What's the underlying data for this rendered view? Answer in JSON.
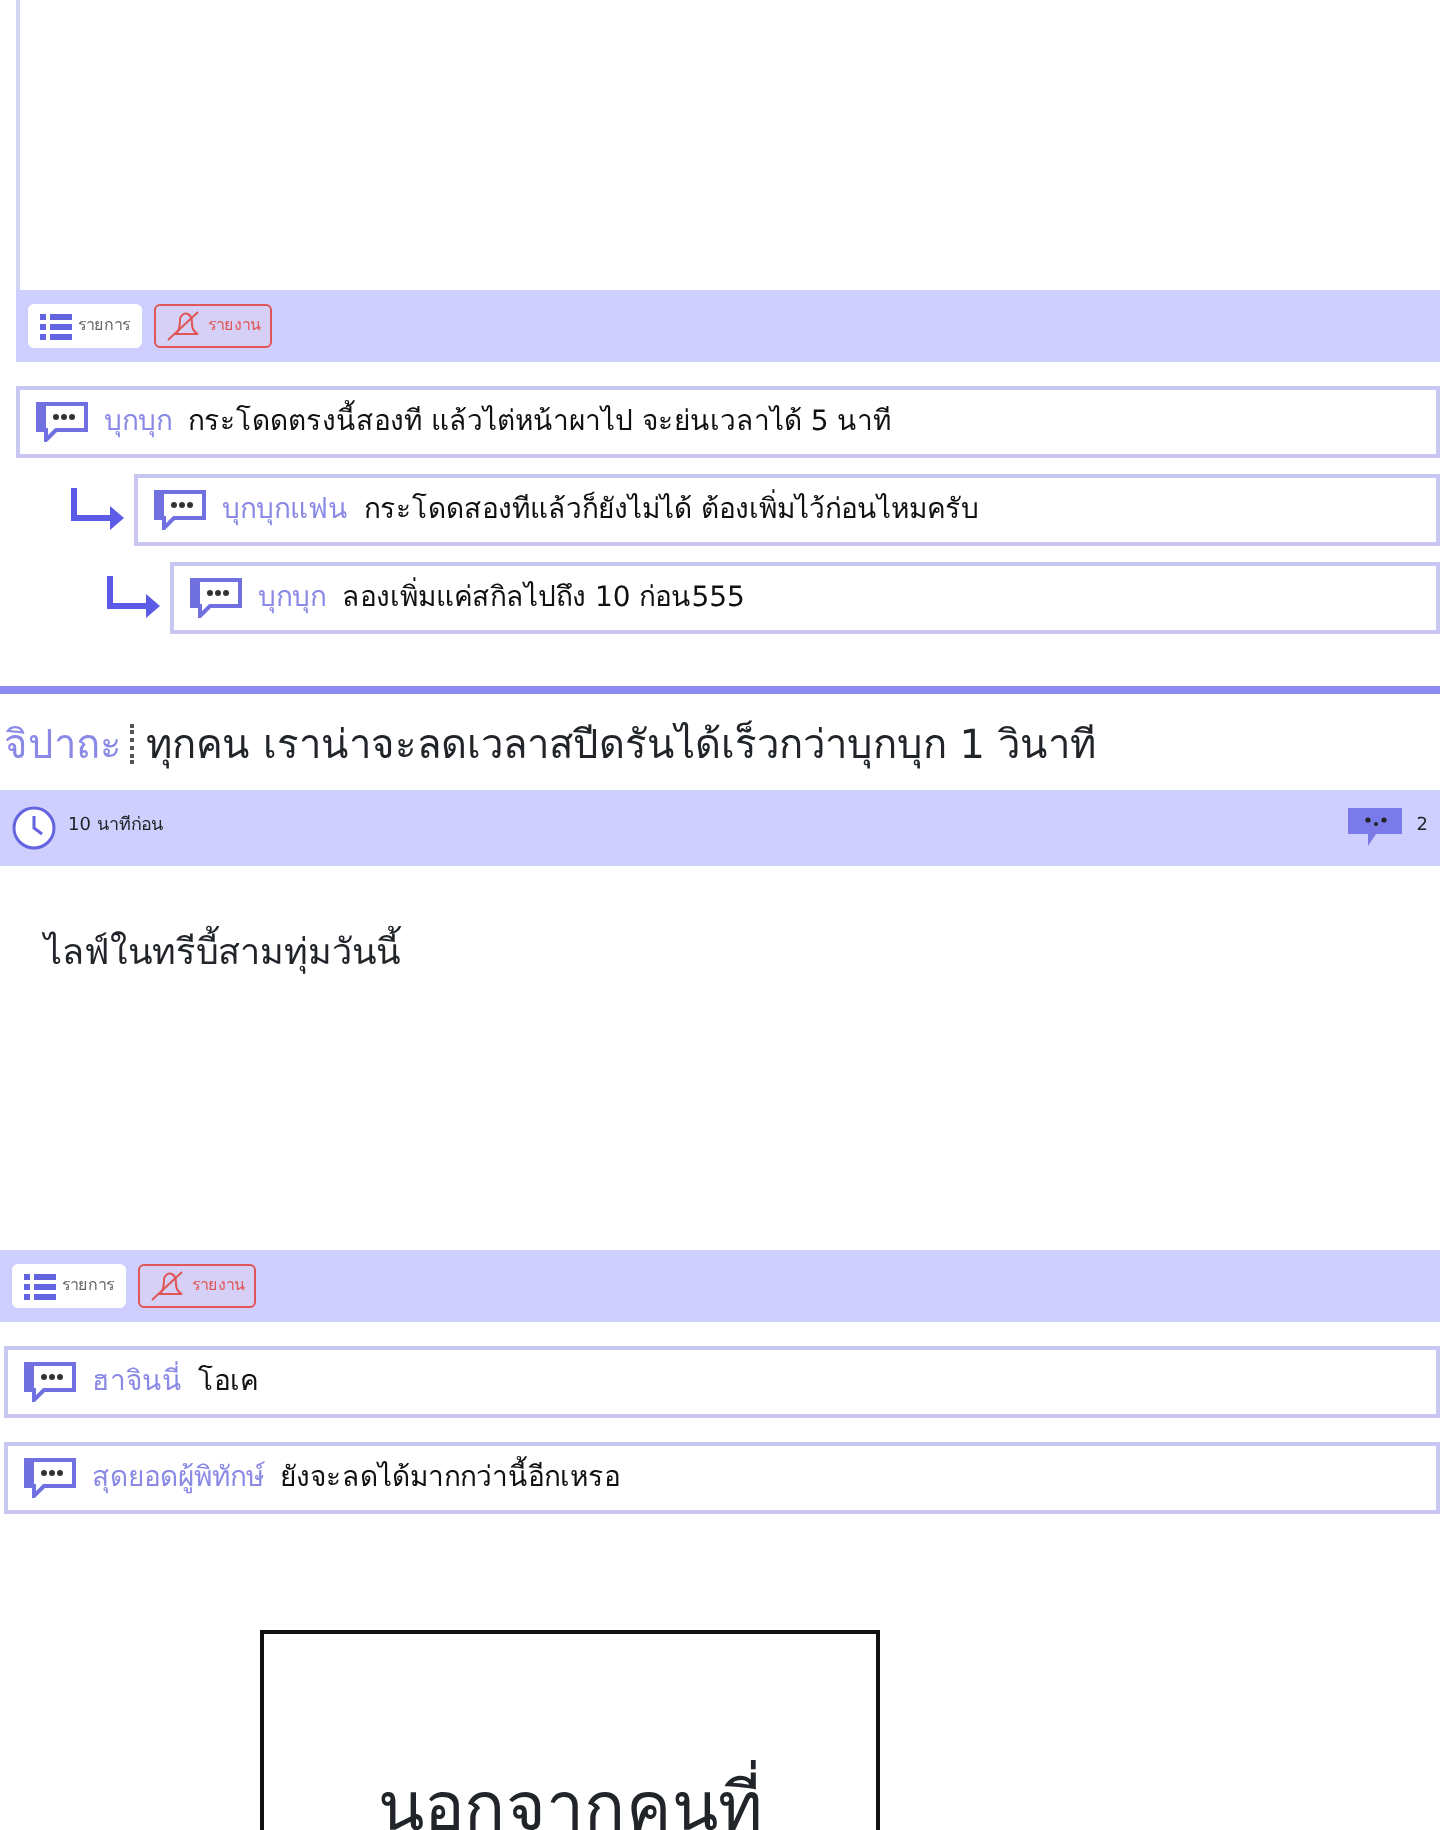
{
  "post_top": {
    "footer_buttons": [
      {
        "kind": "list",
        "label": "รายการ"
      },
      {
        "kind": "report",
        "label": "รายงาน"
      }
    ],
    "comments": [
      {
        "author": "บุกบุก",
        "text": "กระโดดตรงนี้สองที แล้วไต่หน้าผาไป จะย่นเวลาได้ 5 นาที",
        "children": [
          {
            "author": "บุกบุกแฟน",
            "text": "กระโดดสองทีแล้วก็ยังไม่ได้ ต้องเพิ่มไว้ก่อนไหมครับ",
            "children": [
              {
                "author": "บุกบุก",
                "text": "ลองเพิ่มแค่สกิลไปถึง 10 ก่อน555"
              }
            ]
          }
        ]
      }
    ]
  },
  "post": {
    "author": "จิปาถะ",
    "title": "ทุกคน เราน่าจะลดเวลาสปีดรันได้เร็วกว่าบุกบุก 1 วินาที",
    "time": "10 นาทีก่อน",
    "comment_count": "2",
    "body": "ไลฟ์ในทรีบี้สามทุ่มวันนี้",
    "footer_buttons": [
      {
        "kind": "list",
        "label": "รายการ"
      },
      {
        "kind": "report",
        "label": "รายงาน"
      }
    ],
    "comments": [
      {
        "author": "ฮาจินนี่",
        "text": "โอเค"
      },
      {
        "author": "สุดยอดผู้พิทักษ์",
        "text": "ยังจะลดได้มากกว่านี้อีกเหรอ"
      }
    ]
  },
  "caption": {
    "text": "นอกจากคนที่"
  }
}
